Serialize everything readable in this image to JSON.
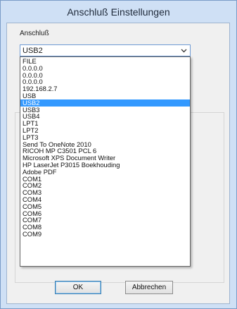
{
  "window": {
    "title": "Anschluß Einstellungen"
  },
  "port": {
    "label": "Anschluß",
    "selected_value": "USB2",
    "selected_index": 6,
    "options": [
      "FILE",
      "0.0.0.0",
      "0.0.0.0",
      "0.0.0.0",
      "192.168.2.7",
      "USB",
      "USB2",
      "USB3",
      "USB4",
      "LPT1",
      "LPT2",
      "LPT3",
      "Send To OneNote 2010",
      "RICOH  MP C3501 PCL 6",
      "Microsoft XPS Document Writer",
      "HP LaserJet P3015 Boekhouding",
      "Adobe PDF",
      "COM1",
      "COM2",
      "COM3",
      "COM4",
      "COM5",
      "COM6",
      "COM7",
      "COM8",
      "COM9"
    ]
  },
  "buttons": {
    "ok_label": "OK",
    "cancel_label": "Abbrechen"
  },
  "colors": {
    "titlebar": "#cfe0f5",
    "selection": "#3399ff",
    "dialog_bg": "#f0f0f0"
  }
}
